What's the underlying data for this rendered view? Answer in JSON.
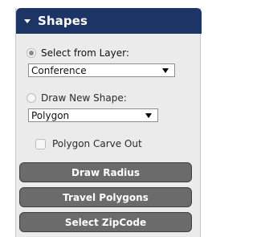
{
  "header": {
    "title": "Shapes",
    "expand_icon": "caret-down-icon"
  },
  "options": {
    "select_from_layer": {
      "label": "Select from Layer:",
      "selected": true
    },
    "draw_new_shape": {
      "label": "Draw New Shape:",
      "selected": false
    }
  },
  "layer_select": {
    "value": "Conference"
  },
  "shape_select": {
    "value": "Polygon"
  },
  "carve_out": {
    "label": "Polygon Carve Out",
    "checked": false
  },
  "buttons": {
    "draw_radius": "Draw Radius",
    "travel_polygons": "Travel Polygons",
    "select_zipcode": "Select ZipCode"
  },
  "colors": {
    "header_bg": "#1d3466",
    "panel_bg": "#ebebeb",
    "button_bg": "#6b6b6b"
  }
}
